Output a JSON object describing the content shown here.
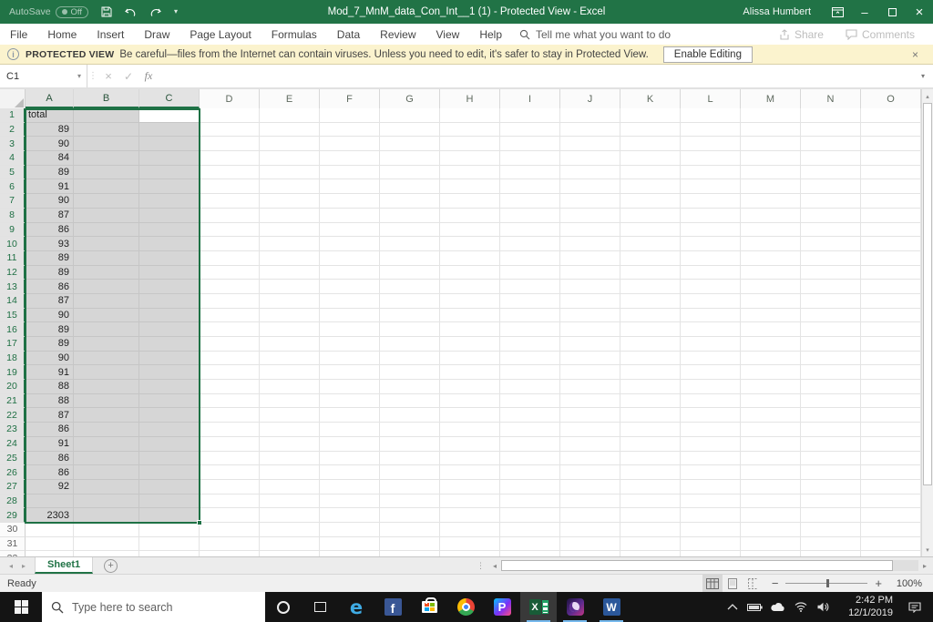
{
  "colors": {
    "excel_green": "#217346",
    "selection_border": "#1E7145",
    "selection_fill": "#D6D6D6",
    "banner_bg": "#FBF3CE",
    "taskbar_bg": "#141414"
  },
  "titlebar": {
    "autosave_label": "AutoSave",
    "autosave_state": "Off",
    "title": "Mod_7_MnM_data_Con_Int__1 (1) - Protected View - Excel",
    "user": "Alissa Humbert"
  },
  "glyphs": {
    "dropdown": "▾",
    "close": "×",
    "minimize": "–",
    "cancel": "×",
    "check": "✓",
    "left": "◂",
    "right": "▸",
    "up": "▴",
    "down": "▾",
    "dots": "⋮",
    "info": "i",
    "add": "+"
  },
  "ribbon": {
    "tabs": [
      "File",
      "Home",
      "Insert",
      "Draw",
      "Page Layout",
      "Formulas",
      "Data",
      "Review",
      "View",
      "Help"
    ],
    "tell_me": "Tell me what you want to do",
    "share": "Share",
    "comments": "Comments"
  },
  "banner": {
    "title": "PROTECTED VIEW",
    "message": "Be careful—files from the Internet can contain viruses. Unless you need to edit, it's safer to stay in Protected View.",
    "button": "Enable Editing"
  },
  "formula_bar": {
    "name_box": "C1",
    "fx": "fx",
    "formula_value": ""
  },
  "sheet": {
    "columns": [
      "A",
      "B",
      "C",
      "D",
      "E",
      "F",
      "G",
      "H",
      "I",
      "J",
      "K",
      "L",
      "M",
      "N",
      "O"
    ],
    "rows_visible": 32,
    "selection": {
      "range": "A1:C29",
      "active_cell": "C1",
      "selected_columns": [
        "A",
        "B",
        "C"
      ],
      "last_selected_row": 29
    },
    "column_a_cells": {
      "1": "total",
      "2": "89",
      "3": "90",
      "4": "84",
      "5": "89",
      "6": "91",
      "7": "90",
      "8": "87",
      "9": "86",
      "10": "93",
      "11": "89",
      "12": "89",
      "13": "86",
      "14": "87",
      "15": "90",
      "16": "89",
      "17": "89",
      "18": "90",
      "19": "91",
      "20": "88",
      "21": "88",
      "22": "87",
      "23": "86",
      "24": "91",
      "25": "86",
      "26": "86",
      "27": "92",
      "29": "2303"
    }
  },
  "sheet_tabs": {
    "active": "Sheet1"
  },
  "status_bar": {
    "mode": "Ready",
    "zoom": "100%"
  },
  "taskbar": {
    "search_placeholder": "Type here to search",
    "icons": {
      "edge": "e",
      "facebook": "f",
      "pandora": "P",
      "excel": "X",
      "word": "W"
    },
    "clock": {
      "time": "2:42 PM",
      "date": "12/1/2019"
    }
  }
}
